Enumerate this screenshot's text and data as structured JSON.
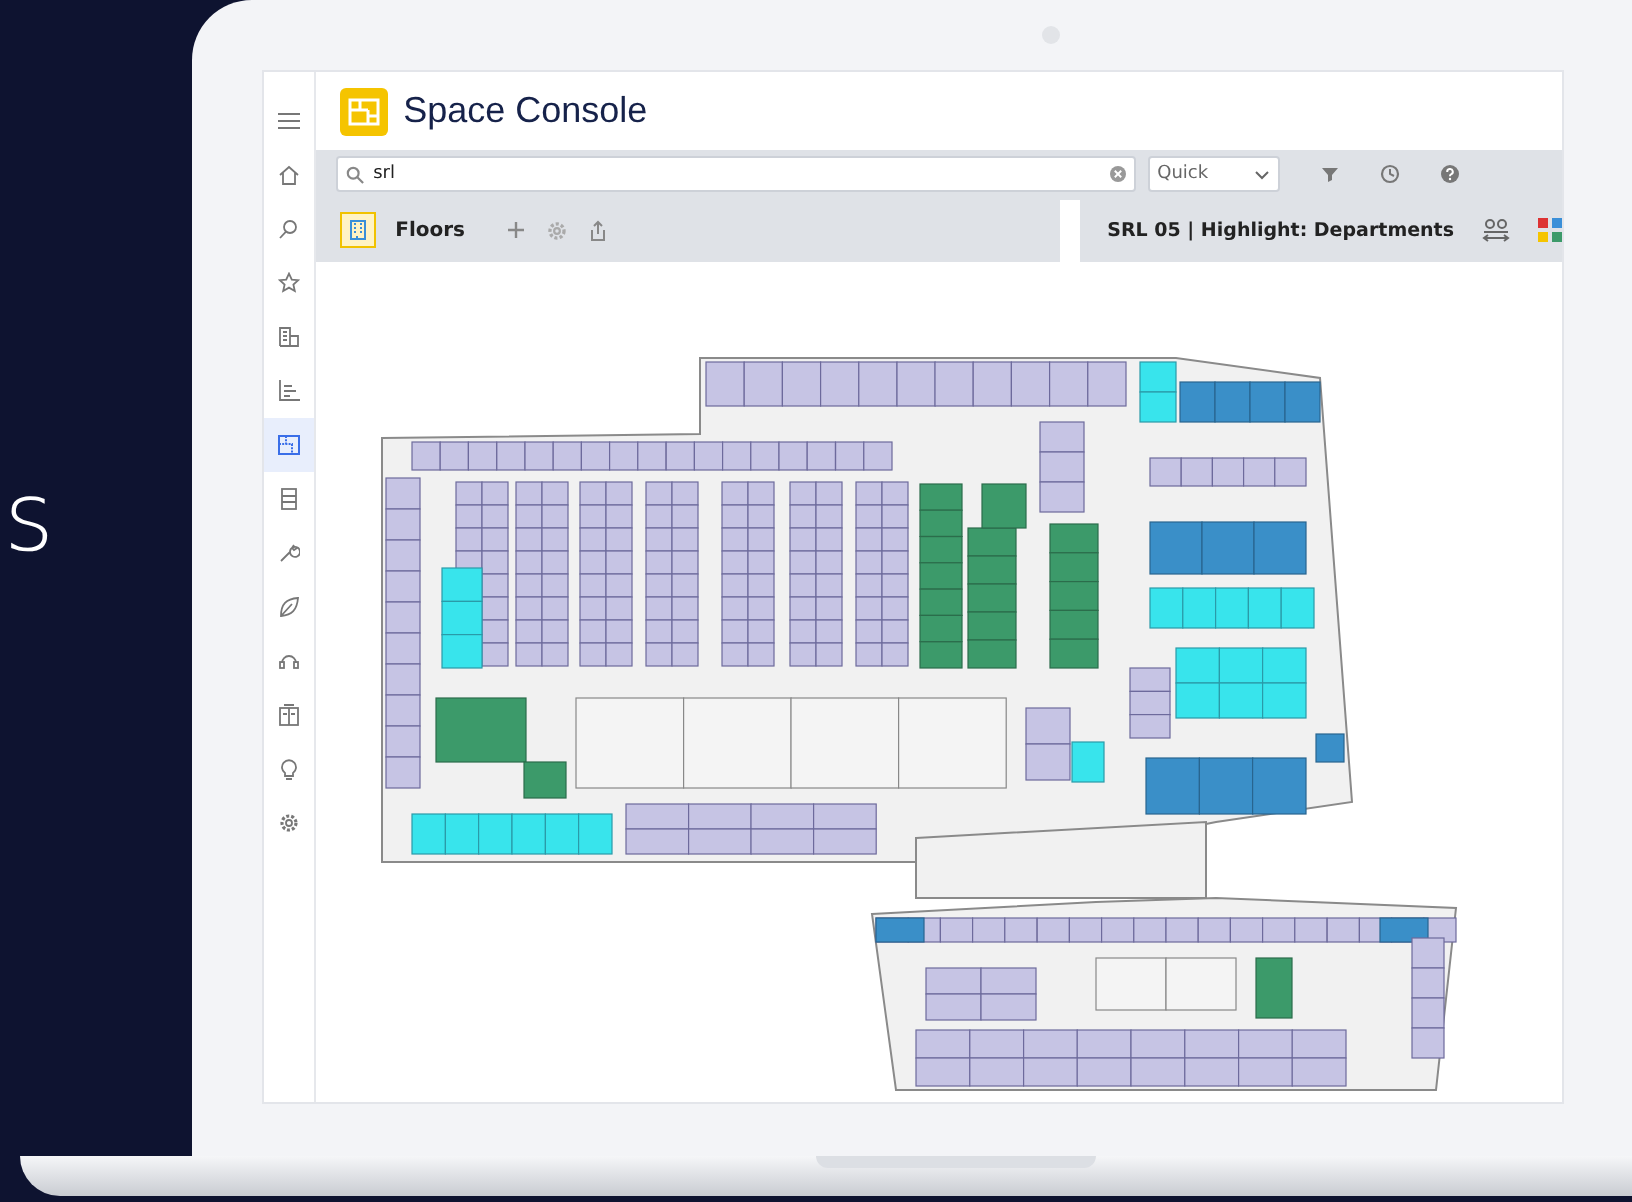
{
  "backdrop_text": "s",
  "app": {
    "title": "Space Console",
    "sidebar": {
      "items": [
        {
          "selected": false
        },
        {
          "selected": false
        },
        {
          "selected": false
        },
        {
          "selected": false
        },
        {
          "selected": false
        },
        {
          "selected": true
        },
        {
          "selected": false
        },
        {
          "selected": false
        },
        {
          "selected": false
        },
        {
          "selected": false
        },
        {
          "selected": false
        },
        {
          "selected": false
        },
        {
          "selected": false
        }
      ]
    },
    "search": {
      "value": "srl"
    },
    "search_mode": {
      "value": "Quick"
    },
    "panel": {
      "title": "Floors"
    },
    "view": {
      "title": "SRL 05 | Highlight: Departments"
    }
  }
}
